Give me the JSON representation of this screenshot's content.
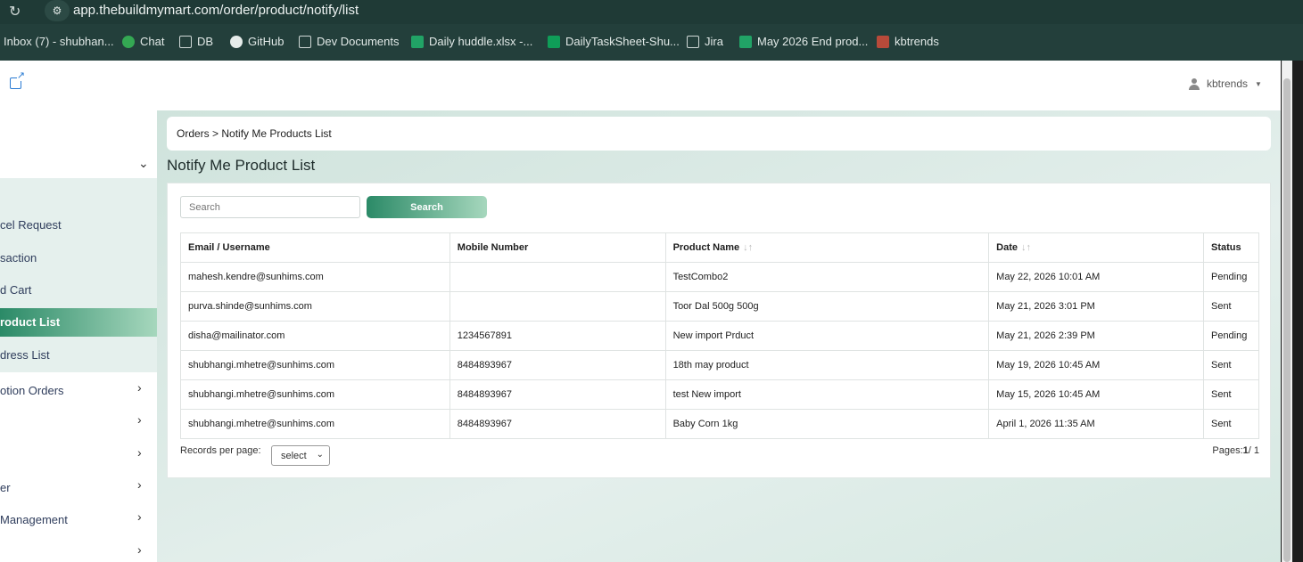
{
  "browser": {
    "url": "app.thebuildmymart.com/order/product/notify/list",
    "bookmarks": [
      {
        "label": "Inbox (7) - shubhan...",
        "icon": "gmail-icon"
      },
      {
        "label": "Chat",
        "icon": "chat-icon"
      },
      {
        "label": "DB",
        "icon": "folder-icon"
      },
      {
        "label": "GitHub",
        "icon": "github-icon"
      },
      {
        "label": "Dev Documents",
        "icon": "folder-icon"
      },
      {
        "label": "Daily huddle.xlsx -...",
        "icon": "sheet-icon"
      },
      {
        "label": "DailyTaskSheet-Shu...",
        "icon": "sheet-icon"
      },
      {
        "label": "Jira",
        "icon": "folder-icon"
      },
      {
        "label": "May 2026 End prod...",
        "icon": "sheet-icon"
      },
      {
        "label": "kbtrends",
        "icon": "kbtrends-icon"
      }
    ]
  },
  "header": {
    "user_name": "kbtrends"
  },
  "sidebar": {
    "items": [
      {
        "label": "cel Request"
      },
      {
        "label": "saction"
      },
      {
        "label": "d Cart"
      },
      {
        "label": "roduct List"
      },
      {
        "label": "dress List"
      },
      {
        "label": "otion Orders"
      },
      {
        "label": "er"
      },
      {
        "label": "Management"
      }
    ]
  },
  "main": {
    "breadcrumb": "Orders > Notify Me Products List",
    "title": "Notify Me Product List",
    "search": {
      "placeholder": "Search",
      "button_label": "Search"
    },
    "table": {
      "columns": [
        "Email / Username",
        "Mobile Number",
        "Product Name",
        "Date",
        "Status"
      ],
      "rows": [
        [
          "mahesh.kendre@sunhims.com",
          "",
          "TestCombo2",
          "May 22, 2026 10:01 AM",
          "Pending"
        ],
        [
          "purva.shinde@sunhims.com",
          "",
          "Toor Dal 500g 500g",
          "May 21, 2026 3:01 PM",
          "Sent"
        ],
        [
          "disha@mailinator.com",
          "1234567891",
          "New import Prduct",
          "May 21, 2026 2:39 PM",
          "Pending"
        ],
        [
          "shubhangi.mhetre@sunhims.com",
          "8484893967",
          "18th may product",
          "May 19, 2026 10:45 AM",
          "Sent"
        ],
        [
          "shubhangi.mhetre@sunhims.com",
          "8484893967",
          "test New import",
          "May 15, 2026 10:45 AM",
          "Sent"
        ],
        [
          "shubhangi.mhetre@sunhims.com",
          "8484893967",
          "Baby Corn 1kg",
          "April 1, 2026 11:35 AM",
          "Sent"
        ]
      ]
    },
    "pagination": {
      "records_label": "Records per page:",
      "select_value": "select",
      "pages_label": "Pages:",
      "current_page": "1",
      "total_pages": "/ 1"
    }
  }
}
